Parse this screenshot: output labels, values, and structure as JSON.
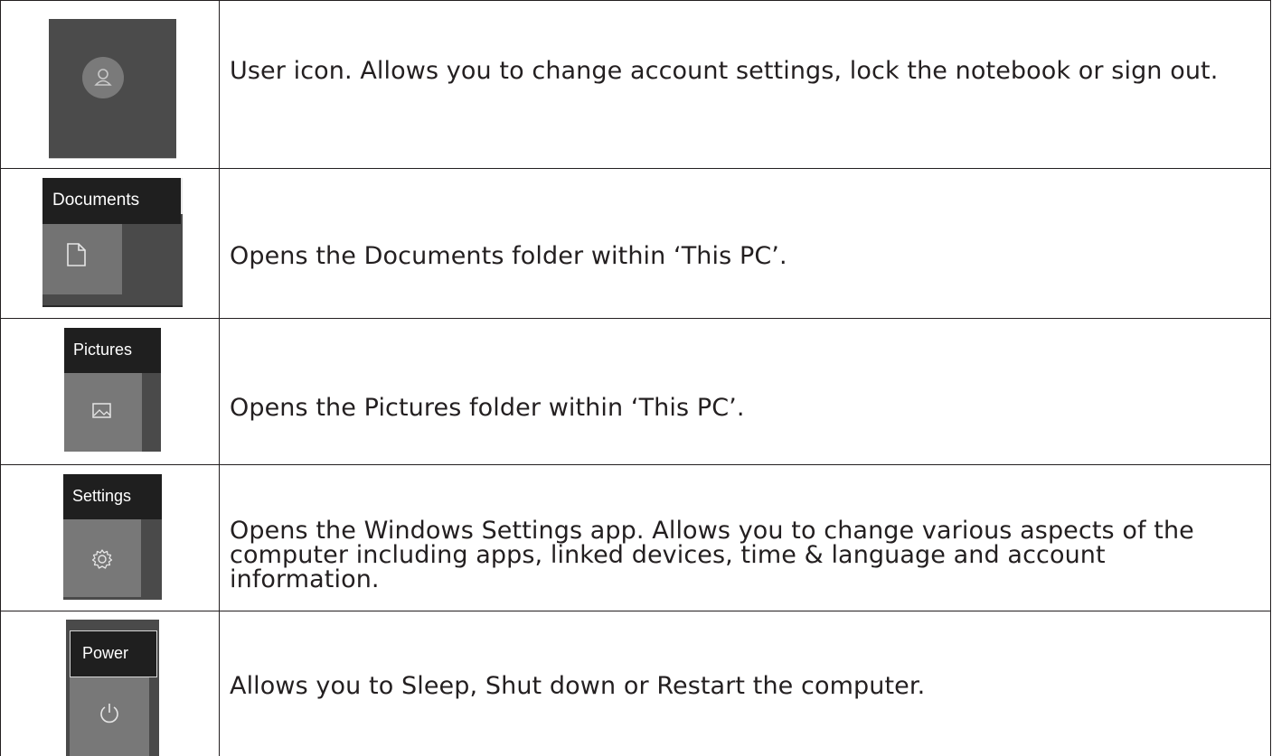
{
  "rows": [
    {
      "icon": "user-icon",
      "description": "User icon. Allows you to change account settings, lock the notebook or sign out."
    },
    {
      "icon": "document-icon",
      "tooltip": "Documents",
      "description": "Opens the Documents folder within ‘This PC’."
    },
    {
      "icon": "picture-icon",
      "tooltip": "Pictures",
      "description": "Opens the Pictures folder within ‘This PC’."
    },
    {
      "icon": "gear-icon",
      "tooltip": "Settings",
      "description": "Opens the Windows Settings app. Allows you to change various aspects of the computer including apps, linked devices, time & language and account information."
    },
    {
      "icon": "power-icon",
      "tooltip": "Power",
      "description": "Allows you to Sleep, Shut down or Restart the computer."
    }
  ],
  "colors": {
    "border": "#231f20",
    "text": "#231f20",
    "taskbar_dark": "#4a4a4a",
    "tooltip_bg": "#1f1f1f",
    "tile": "#777777"
  }
}
